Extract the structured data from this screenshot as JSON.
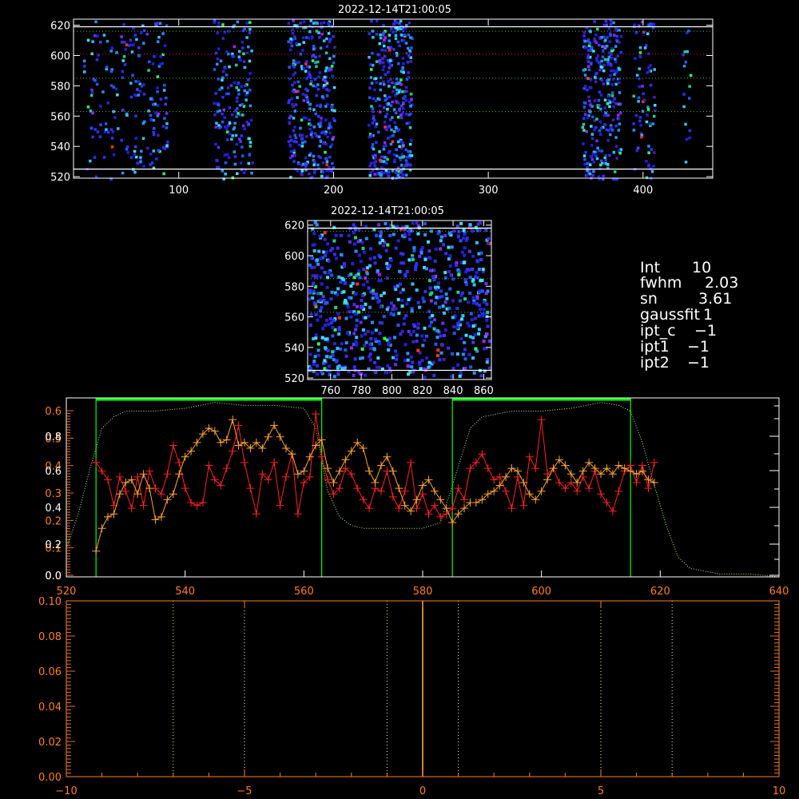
{
  "colors": {
    "axis_white": "#ffffff",
    "axis_orange": "#ff7f1f",
    "red_series": "#ff2020",
    "orange_series": "#ffa530",
    "green": "#00ff00",
    "dotted_green": "#b0ff90"
  },
  "info_panel": {
    "int_label": "Int",
    "int_value": "10",
    "fwhm_label": "fwhm",
    "fwhm_value": "2.03",
    "sn_label": "sn",
    "sn_value": "3.61",
    "gaussfit_label": "gaussfit",
    "gaussfit_value": "1",
    "ipt_c_label": "ipt_c",
    "ipt_c_value": "−1",
    "ipt1_label": "ipt1",
    "ipt1_value": "−1",
    "ipt2_label": "ipt2",
    "ipt2_value": "−1"
  },
  "chart_data": [
    {
      "type": "heatmap",
      "title": "2022-12-14T21:00:05",
      "xlim": [
        32,
        445
      ],
      "ylim": [
        519,
        624
      ],
      "xticks": [
        100,
        200,
        300,
        400
      ],
      "yticks": [
        520,
        540,
        560,
        580,
        600,
        620
      ],
      "white_lines_y": [
        619,
        525
      ],
      "dotted_green_y": [
        616,
        585,
        563
      ],
      "dotted_red_y": [
        601
      ],
      "columns": [
        {
          "x0": 38,
          "x1": 60,
          "density": 0.1
        },
        {
          "x0": 62,
          "x1": 92,
          "density": 0.16
        },
        {
          "x0": 122,
          "x1": 147,
          "density": 0.24
        },
        {
          "x0": 170,
          "x1": 200,
          "density": 0.38
        },
        {
          "x0": 222,
          "x1": 250,
          "density": 0.45
        },
        {
          "x0": 360,
          "x1": 385,
          "density": 0.4
        },
        {
          "x0": 393,
          "x1": 407,
          "density": 0.2
        },
        {
          "x0": 425,
          "x1": 430,
          "density": 0.12
        }
      ]
    },
    {
      "type": "heatmap",
      "title": "2022-12-14T21:00:05",
      "xlim": [
        745,
        865
      ],
      "ylim": [
        519,
        623
      ],
      "xticks": [
        760,
        780,
        800,
        820,
        840,
        860
      ],
      "yticks": [
        520,
        540,
        560,
        580,
        600,
        620
      ],
      "white_lines_y": [
        618,
        525
      ],
      "dotted_green_y": [
        616,
        585,
        563
      ],
      "density": 0.22
    },
    {
      "type": "line",
      "xlim": [
        520,
        640
      ],
      "xticks": [
        520,
        540,
        560,
        580,
        600,
        620,
        640
      ],
      "left_ticks_orange": [
        "0.0",
        "0.1",
        "0.2",
        "0.3",
        "0.4",
        "0.5",
        "0.6"
      ],
      "left_ticks_white": [
        "0.0",
        "0.2",
        "0.4",
        "0.6",
        "0.8"
      ],
      "green_windows": [
        [
          525,
          563
        ],
        [
          585,
          615
        ]
      ],
      "series": [
        {
          "x": [
            525,
            526,
            527,
            528,
            529,
            530,
            531,
            532,
            533,
            534,
            535,
            536,
            537,
            538,
            539,
            540,
            541,
            542,
            543,
            544,
            545,
            546,
            547,
            548,
            549,
            550,
            551,
            552,
            553,
            554,
            555,
            556,
            557,
            558,
            559,
            560,
            561,
            562,
            563,
            564,
            565,
            566,
            567,
            568,
            569,
            570,
            571,
            572,
            573,
            574,
            575,
            576,
            577,
            578,
            579,
            580,
            581,
            582,
            583,
            584,
            585,
            586,
            587,
            588,
            589,
            590,
            591,
            592,
            593,
            594,
            595,
            596,
            597,
            598,
            599,
            600,
            601,
            602,
            603,
            604,
            605,
            606,
            607,
            608,
            609,
            610,
            611,
            612,
            613,
            614,
            615,
            616,
            617,
            618,
            619
          ],
          "values": [
            0.4,
            0.37,
            0.34,
            0.25,
            0.35,
            0.3,
            0.24,
            0.35,
            0.25,
            0.37,
            0.31,
            0.29,
            0.36,
            0.46,
            0.4,
            0.31,
            0.26,
            0.25,
            0.26,
            0.39,
            0.34,
            0.32,
            0.38,
            0.44,
            0.53,
            0.4,
            0.31,
            0.22,
            0.36,
            0.34,
            0.4,
            0.25,
            0.35,
            0.43,
            0.22,
            0.33,
            0.35,
            0.57,
            0.42,
            0.34,
            0.29,
            0.31,
            0.38,
            0.36,
            0.31,
            0.27,
            0.24,
            0.31,
            0.3,
            0.37,
            0.28,
            0.24,
            0.3,
            0.4,
            0.24,
            0.29,
            0.22,
            0.25,
            0.21,
            0.22,
            0.24,
            0.31,
            0.27,
            0.38,
            0.4,
            0.43,
            0.38,
            0.34,
            0.35,
            0.3,
            0.24,
            0.35,
            0.25,
            0.42,
            0.38,
            0.55,
            0.36,
            0.38,
            0.33,
            0.31,
            0.33,
            0.3,
            0.35,
            0.31,
            0.37,
            0.29,
            0.26,
            0.23,
            0.3,
            0.37,
            0.39,
            0.33,
            0.39,
            0.31,
            0.4
          ]
        },
        {
          "x": [
            525,
            526,
            527,
            528,
            529,
            530,
            531,
            532,
            533,
            534,
            535,
            536,
            537,
            538,
            539,
            540,
            541,
            542,
            543,
            544,
            545,
            546,
            547,
            548,
            549,
            550,
            551,
            552,
            553,
            554,
            555,
            556,
            557,
            558,
            559,
            560,
            561,
            562,
            563,
            564,
            565,
            566,
            567,
            568,
            569,
            570,
            571,
            572,
            573,
            574,
            575,
            576,
            577,
            578,
            579,
            580,
            581,
            582,
            583,
            584,
            585,
            586,
            587,
            588,
            589,
            590,
            591,
            592,
            593,
            594,
            595,
            596,
            597,
            598,
            599,
            600,
            601,
            602,
            603,
            604,
            605,
            606,
            607,
            608,
            609,
            610,
            611,
            612,
            613,
            614,
            615,
            616,
            617,
            618,
            619
          ],
          "values": [
            0.09,
            0.17,
            0.21,
            0.22,
            0.29,
            0.33,
            0.34,
            0.29,
            0.36,
            0.31,
            0.2,
            0.21,
            0.27,
            0.29,
            0.36,
            0.42,
            0.44,
            0.47,
            0.5,
            0.52,
            0.51,
            0.47,
            0.48,
            0.55,
            0.46,
            0.47,
            0.45,
            0.47,
            0.45,
            0.49,
            0.53,
            0.49,
            0.45,
            0.43,
            0.36,
            0.37,
            0.42,
            0.46,
            0.48,
            0.38,
            0.33,
            0.37,
            0.41,
            0.44,
            0.47,
            0.45,
            0.37,
            0.33,
            0.39,
            0.42,
            0.37,
            0.31,
            0.25,
            0.23,
            0.27,
            0.32,
            0.34,
            0.3,
            0.27,
            0.24,
            0.19,
            0.22,
            0.24,
            0.26,
            0.26,
            0.27,
            0.29,
            0.3,
            0.32,
            0.35,
            0.38,
            0.37,
            0.33,
            0.29,
            0.27,
            0.3,
            0.34,
            0.38,
            0.41,
            0.39,
            0.36,
            0.33,
            0.37,
            0.4,
            0.38,
            0.36,
            0.38,
            0.36,
            0.39,
            0.38,
            0.37,
            0.36,
            0.37,
            0.34,
            0.33
          ]
        },
        {
          "x": [
            520,
            522,
            524,
            526,
            528,
            530,
            535,
            540,
            545,
            550,
            555,
            560,
            562,
            564,
            566,
            568,
            570,
            575,
            580,
            583,
            585,
            588,
            590,
            595,
            600,
            605,
            610,
            613,
            615,
            617,
            619,
            621,
            623,
            625,
            630,
            635,
            640
          ],
          "values": [
            0.1,
            0.22,
            0.38,
            0.52,
            0.56,
            0.58,
            0.58,
            0.59,
            0.61,
            0.6,
            0.6,
            0.59,
            0.52,
            0.3,
            0.21,
            0.18,
            0.17,
            0.17,
            0.17,
            0.19,
            0.32,
            0.52,
            0.56,
            0.58,
            0.58,
            0.59,
            0.61,
            0.6,
            0.58,
            0.47,
            0.32,
            0.18,
            0.07,
            0.03,
            0.01,
            0.01,
            0.0
          ]
        }
      ]
    },
    {
      "type": "line",
      "xlim": [
        -10,
        10
      ],
      "ylim": [
        0.0,
        0.1
      ],
      "xticks": [
        -10,
        -5,
        0,
        5,
        10
      ],
      "yticks": [
        "0.00",
        "0.02",
        "0.04",
        "0.06",
        "0.08",
        "0.10"
      ],
      "dotted_x": [
        -7,
        -5,
        -1,
        1,
        5,
        7
      ],
      "center_x": 0
    }
  ]
}
